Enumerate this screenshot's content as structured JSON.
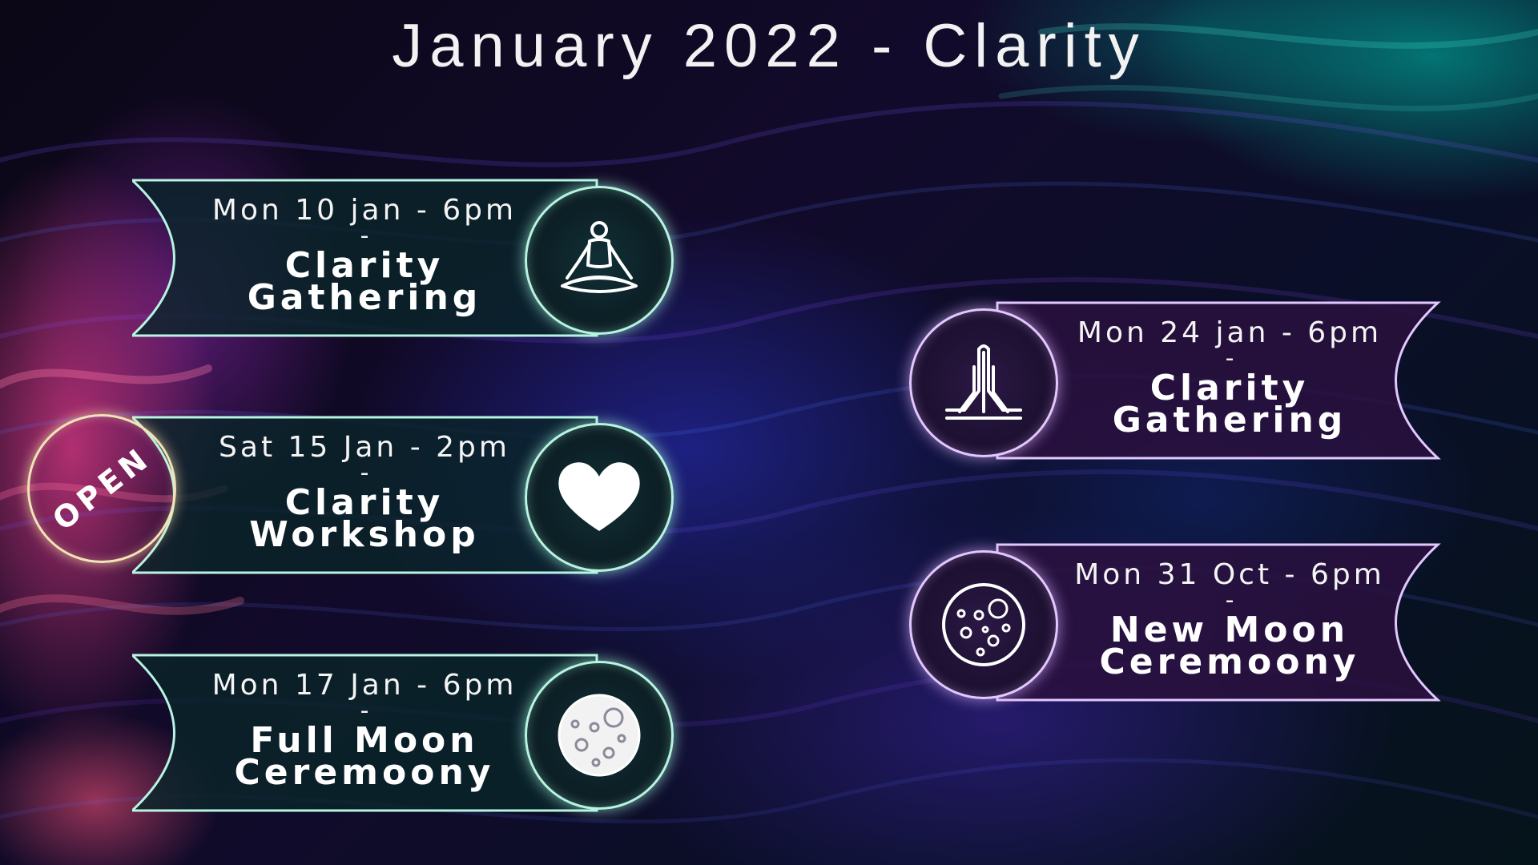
{
  "title": "January 2022 - Clarity",
  "badge": {
    "label": "OPEN"
  },
  "events": [
    {
      "date": "Mon 10 jan - 6pm",
      "separator": "-",
      "name_line1": "Clarity",
      "name_line2": "Gathering",
      "icon": "meditation-icon"
    },
    {
      "date": "Sat 15 Jan - 2pm",
      "separator": "-",
      "name_line1": "Clarity",
      "name_line2": "Workshop",
      "icon": "heart-icon"
    },
    {
      "date": "Mon 17 Jan - 6pm",
      "separator": "-",
      "name_line1": "Full Moon",
      "name_line2": "Ceremoony",
      "icon": "full-moon-icon"
    },
    {
      "date": "Mon 24 jan - 6pm",
      "separator": "-",
      "name_line1": "Clarity",
      "name_line2": "Gathering",
      "icon": "praying-hands-icon"
    },
    {
      "date": "Mon 31 Oct - 6pm",
      "separator": "-",
      "name_line1": "New Moon",
      "name_line2": "Ceremoony",
      "icon": "new-moon-icon"
    }
  ],
  "colors": {
    "left_ribbon_stroke": "#b7f4e1",
    "right_ribbon_stroke": "#e3c8ff",
    "badge_stroke": "#f3e3b8"
  }
}
